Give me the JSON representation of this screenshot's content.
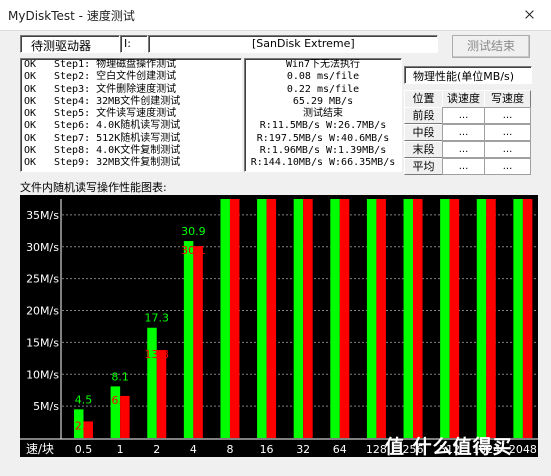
{
  "window": {
    "title": "MyDiskTest - 速度测试"
  },
  "toolbar": {
    "drive_label": "待测驱动器",
    "drive_letter": "I:",
    "drive_name": "[SanDisk Extreme]",
    "test_button": "测试结束"
  },
  "steps": [
    {
      "status": "OK",
      "text": "Step1: 物理磁盘操作测试"
    },
    {
      "status": "OK",
      "text": "Step2: 空白文件创建测试"
    },
    {
      "status": "OK",
      "text": "Step3: 文件删除速度测试"
    },
    {
      "status": "OK",
      "text": "Step4: 32MB文件创建测试"
    },
    {
      "status": "OK",
      "text": "Step5: 文件读写速度测试"
    },
    {
      "status": "OK",
      "text": "Step6: 4.0K随机读写测试"
    },
    {
      "status": "OK",
      "text": "Step7: 512K随机读写测试"
    },
    {
      "status": "OK",
      "text": "Step8: 4.0K文件复制测试"
    },
    {
      "status": "OK",
      "text": "Step9: 32MB文件复制测试"
    }
  ],
  "results": [
    "Win7下无法执行",
    "0.08 ms/file",
    "0.22 ms/file",
    "65.29 MB/s",
    "测试结束",
    "R:11.5MB/s W:26.7MB/s",
    "R:197.5MB/s W:40.6MB/s",
    "R:1.96MB/s W:1.39MB/s",
    "R:144.10MB/s W:66.35MB/s"
  ],
  "perf": {
    "title": "物理性能(单位MB/s)",
    "headers": [
      "位置",
      "读速度",
      "写速度"
    ],
    "rows": [
      {
        "pos": "前段",
        "read": "...",
        "write": "..."
      },
      {
        "pos": "中段",
        "read": "...",
        "write": "..."
      },
      {
        "pos": "末段",
        "read": "...",
        "write": "..."
      },
      {
        "pos": "平均",
        "read": "...",
        "write": "..."
      }
    ]
  },
  "chart_title": "文件内随机读写操作性能图表:",
  "watermark": "值 什么值得买",
  "chart_data": {
    "type": "bar",
    "xlabel": "速/块",
    "categories": [
      "0.5",
      "1",
      "2",
      "4",
      "8",
      "16",
      "32",
      "64",
      "128",
      "256",
      "512",
      "1024",
      "2048"
    ],
    "y_ticks": [
      "5M/s",
      "10M/s",
      "15M/s",
      "20M/s",
      "25M/s",
      "30M/s",
      "35M/s"
    ],
    "ylim": [
      0,
      37.5
    ],
    "series": [
      {
        "name": "write",
        "color": "#00ff00",
        "values": [
          4.5,
          8.1,
          17.3,
          30.9,
          37.5,
          37.5,
          37.5,
          37.5,
          37.5,
          37.5,
          37.5,
          37.5,
          37.5
        ],
        "labels": [
          "4.5",
          "8.1",
          "17.3",
          "30.9",
          "",
          "",
          "",
          "",
          "",
          "",
          "",
          "",
          ""
        ]
      },
      {
        "name": "read",
        "color": "#ff0000",
        "values": [
          2.6,
          6.6,
          13.8,
          30.1,
          37.5,
          37.5,
          37.5,
          37.5,
          37.5,
          37.5,
          37.5,
          37.5,
          37.5
        ],
        "labels": [
          "2.6",
          "6.6",
          "13.8",
          "30.1",
          "",
          "",
          "",
          "",
          "",
          "",
          "",
          "",
          ""
        ]
      }
    ],
    "grid": true,
    "legend": "none"
  }
}
